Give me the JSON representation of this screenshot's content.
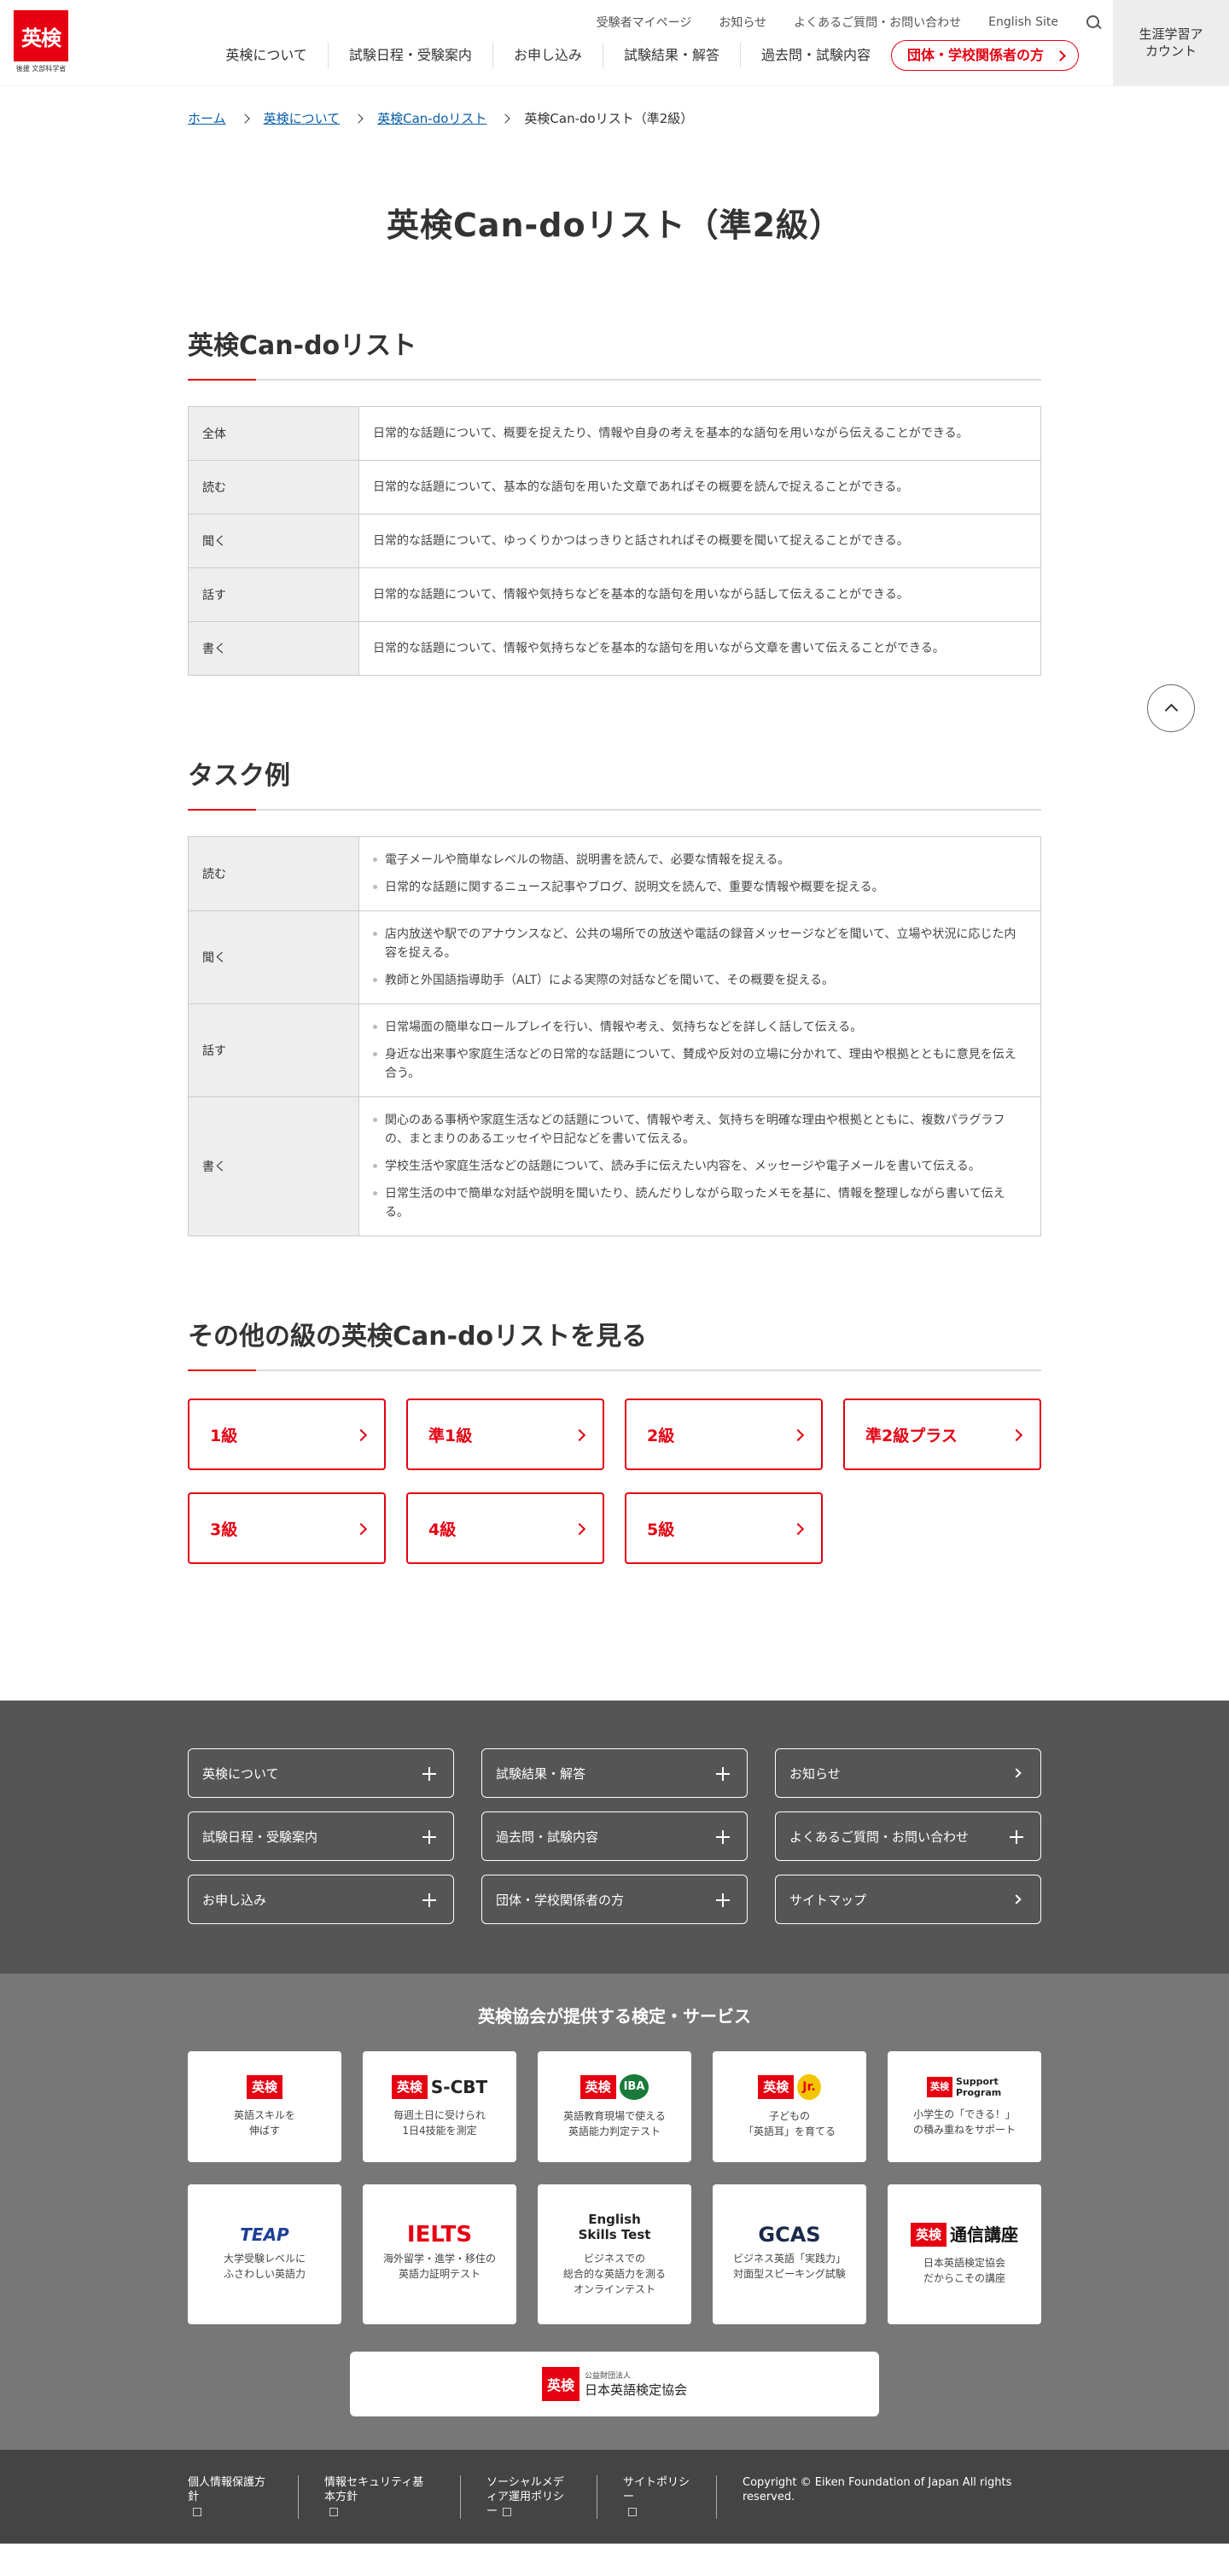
{
  "header": {
    "logo_text": "英検",
    "logo_sub": "後援 文部科学省",
    "util_nav": [
      "受験者マイページ",
      "お知らせ",
      "よくあるご質問・お問い合わせ",
      "English Site"
    ],
    "main_nav": [
      "英検について",
      "試験日程・受験案内",
      "お申し込み",
      "試験結果・解答",
      "過去問・試験内容"
    ],
    "group_button": "団体・学校関係者の方",
    "account_button": "生涯学習アカウント"
  },
  "breadcrumb": {
    "home": "ホーム",
    "about": "英検について",
    "cando": "英検Can-doリスト",
    "current": "英検Can-doリスト（準2級）"
  },
  "page_title": "英検Can-doリスト（準2級）",
  "cando_section": {
    "title": "英検Can-doリスト",
    "rows": [
      {
        "label": "全体",
        "text": "日常的な話題について、概要を捉えたり、情報や自身の考えを基本的な語句を用いながら伝えることができる。"
      },
      {
        "label": "読む",
        "text": "日常的な話題について、基本的な語句を用いた文章であればその概要を読んで捉えることができる。"
      },
      {
        "label": "聞く",
        "text": "日常的な話題について、ゆっくりかつはっきりと話されればその概要を聞いて捉えることができる。"
      },
      {
        "label": "話す",
        "text": "日常的な話題について、情報や気持ちなどを基本的な語句を用いながら話して伝えることができる。"
      },
      {
        "label": "書く",
        "text": "日常的な話題について、情報や気持ちなどを基本的な語句を用いながら文章を書いて伝えることができる。"
      }
    ]
  },
  "task_section": {
    "title": "タスク例",
    "rows": [
      {
        "label": "読む",
        "items": [
          "電子メールや簡単なレベルの物語、説明書を読んで、必要な情報を捉える。",
          "日常的な話題に関するニュース記事やブログ、説明文を読んで、重要な情報や概要を捉える。"
        ]
      },
      {
        "label": "聞く",
        "items": [
          "店内放送や駅でのアナウンスなど、公共の場所での放送や電話の録音メッセージなどを聞いて、立場や状況に応じた内容を捉える。",
          "教師と外国語指導助手（ALT）による実際の対話などを聞いて、その概要を捉える。"
        ]
      },
      {
        "label": "話す",
        "items": [
          "日常場面の簡単なロールプレイを行い、情報や考え、気持ちなどを詳しく話して伝える。",
          "身近な出来事や家庭生活などの日常的な話題について、賛成や反対の立場に分かれて、理由や根拠とともに意見を伝え合う。"
        ]
      },
      {
        "label": "書く",
        "items": [
          "関心のある事柄や家庭生活などの話題について、情報や考え、気持ちを明確な理由や根拠とともに、複数パラグラフの、まとまりのあるエッセイや日記などを書いて伝える。",
          "学校生活や家庭生活などの話題について、読み手に伝えたい内容を、メッセージや電子メールを書いて伝える。",
          "日常生活の中で簡単な対話や説明を聞いたり、読んだりしながら取ったメモを基に、情報を整理しながら書いて伝える。"
        ]
      }
    ]
  },
  "other_section": {
    "title": "その他の級の英検Can-doリストを見る",
    "grades": [
      "1級",
      "準1級",
      "2級",
      "準2級プラス",
      "3級",
      "4級",
      "5級"
    ]
  },
  "footer_nav": [
    {
      "label": "英検について",
      "type": "plus"
    },
    {
      "label": "試験結果・解答",
      "type": "plus"
    },
    {
      "label": "お知らせ",
      "type": "chevron"
    },
    {
      "label": "試験日程・受験案内",
      "type": "plus"
    },
    {
      "label": "過去問・試験内容",
      "type": "plus"
    },
    {
      "label": "よくあるご質問・お問い合わせ",
      "type": "plus"
    },
    {
      "label": "お申し込み",
      "type": "plus"
    },
    {
      "label": "団体・学校関係者の方",
      "type": "plus"
    },
    {
      "label": "サイトマップ",
      "type": "chevron"
    }
  ],
  "services": {
    "title": "英検協会が提供する検定・サービス",
    "items": [
      {
        "logo_badge": "英検",
        "logo_text": "",
        "desc": "英語スキルを\n伸ばす"
      },
      {
        "logo_badge": "英検",
        "logo_text": "S-CBT",
        "desc": "毎週土日に受けられ\n1日4技能を測定"
      },
      {
        "logo_badge": "英検",
        "logo_text": "IBA",
        "desc": "英語教育現場で使える\n英語能力判定テスト"
      },
      {
        "logo_badge": "英検",
        "logo_text": "Jr.",
        "desc": "子どもの\n「英語耳」を育てる"
      },
      {
        "logo_badge": "英検",
        "logo_text": "Support Program",
        "desc": "小学生の「できる！」\nの積み重ねをサポート"
      },
      {
        "logo_badge": "",
        "logo_text": "TEAP",
        "desc": "大学受験レベルに\nふさわしい英語力"
      },
      {
        "logo_badge": "",
        "logo_text": "IELTS",
        "desc": "海外留学・進学・移住の\n英語力証明テスト"
      },
      {
        "logo_badge": "",
        "logo_text": "English Skills Test",
        "desc": "ビジネスでの\n総合的な英語力を測る\nオンラインテスト"
      },
      {
        "logo_badge": "",
        "logo_text": "GCAS",
        "desc": "ビジネス英語「実践力」\n対面型スピーキング試験"
      },
      {
        "logo_badge": "英検",
        "logo_text": "通信講座",
        "desc": "日本英語検定協会\nだからこその講座"
      }
    ],
    "assoc_badge": "英検",
    "assoc_small": "公益財団法人",
    "assoc_name": "日本英語検定協会"
  },
  "bottom": {
    "links": [
      "個人情報保護方針",
      "情報セキュリティ基本方針",
      "ソーシャルメディア運用ポリシー",
      "サイトポリシー"
    ],
    "copyright": "Copyright © Eiken Foundation of Japan All rights reserved."
  },
  "colors": {
    "accent": "#e60012",
    "footer_dark": "#555555",
    "footer_mid": "#777777",
    "footer_bottom": "#444444"
  }
}
